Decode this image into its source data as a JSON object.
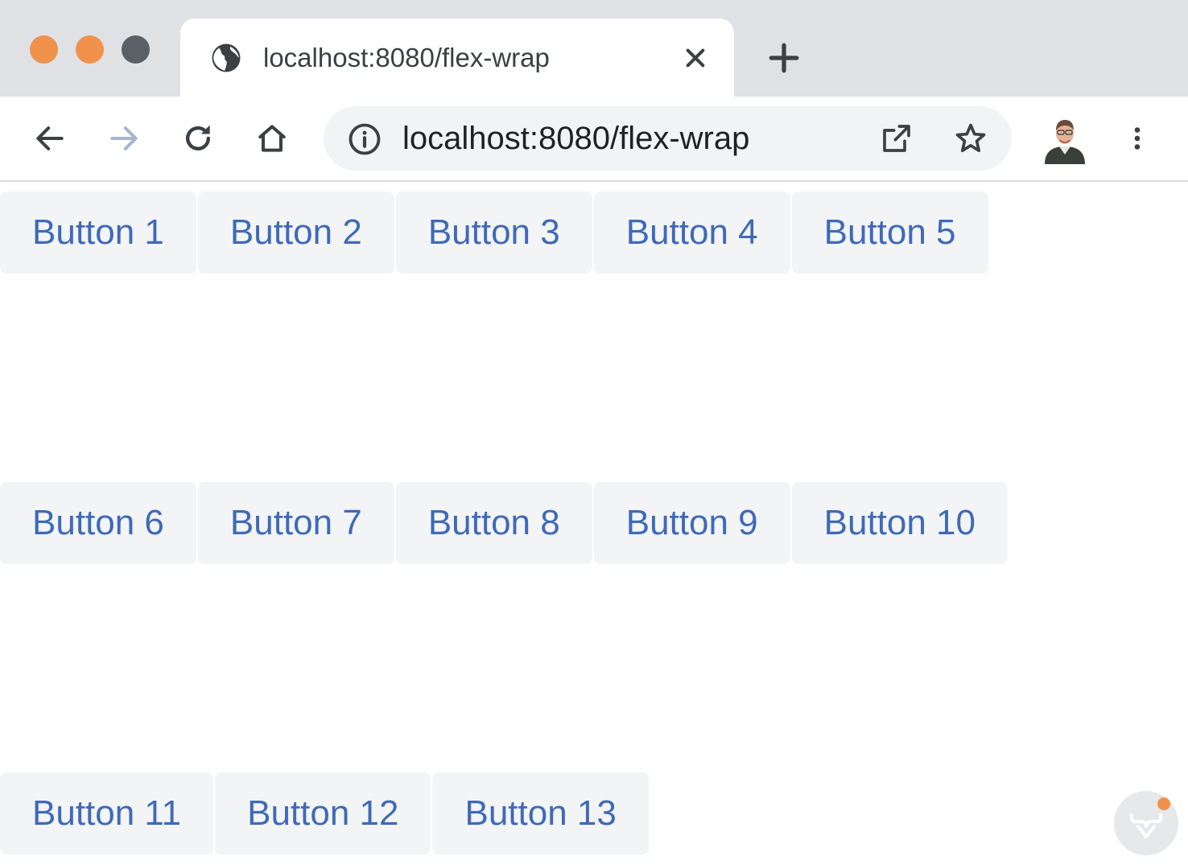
{
  "window": {
    "tab_title": "localhost:8080/flex-wrap",
    "url": "localhost:8080/flex-wrap"
  },
  "icons": {
    "traffic_lights": [
      "close-dot",
      "minimize-dot",
      "zoom-dot"
    ],
    "tab": [
      "globe-icon",
      "close-icon"
    ],
    "toolbar": [
      "back-icon",
      "forward-icon",
      "reload-icon",
      "home-icon",
      "info-icon",
      "open-in-new-icon",
      "star-icon",
      "avatar",
      "more-vert-icon"
    ]
  },
  "colors": {
    "accent_orange": "#f0924c",
    "button_text": "#3f6ab8",
    "button_bg": "#f3f4f6"
  },
  "content": {
    "rows": [
      [
        "Button 1",
        "Button 2",
        "Button 3",
        "Button 4",
        "Button 5"
      ],
      [
        "Button 6",
        "Button 7",
        "Button 8",
        "Button 9",
        "Button 10"
      ],
      [
        "Button 11",
        "Button 12",
        "Button 13"
      ]
    ]
  }
}
